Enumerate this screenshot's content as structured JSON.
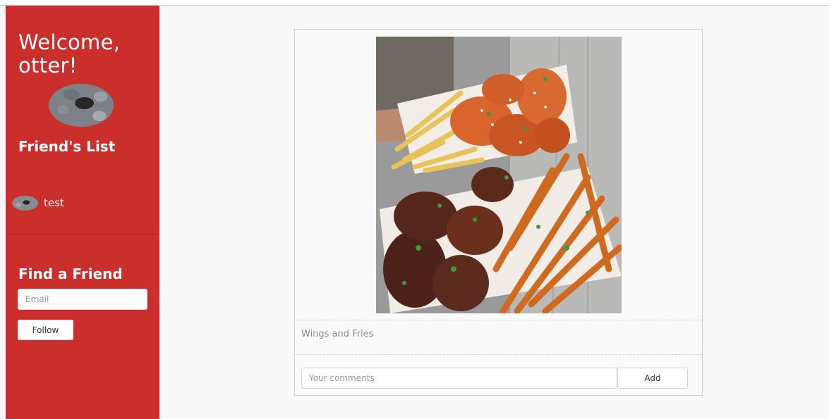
{
  "sidebar": {
    "welcome": "Welcome, otter!",
    "friends_title": "Friend's List",
    "friends": [
      {
        "name": "test"
      }
    ],
    "find_title": "Find a Friend",
    "email_placeholder": "Email",
    "follow_label": "Follow",
    "background_color": "#cb2f2c"
  },
  "post": {
    "caption": "Wings and Fries",
    "comment_placeholder": "Your comments",
    "add_label": "Add"
  }
}
